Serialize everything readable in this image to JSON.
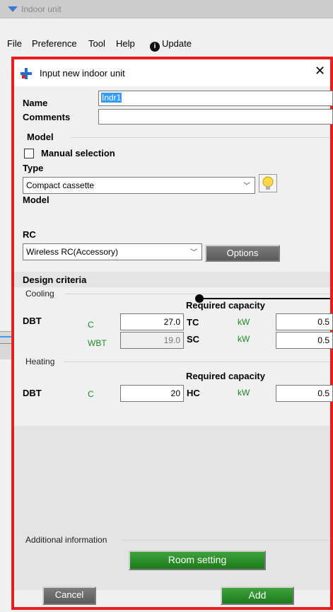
{
  "window": {
    "title": "Indoor unit"
  },
  "menu": {
    "file": "File",
    "preference": "Preference",
    "tool": "Tool",
    "help": "Help",
    "update": "Update"
  },
  "dialog": {
    "title": "Input new indoor unit",
    "name_label": "Name",
    "name_value": "Indr1",
    "comments_label": "Comments",
    "comments_value": "",
    "model_group": "Model",
    "manual_selection": "Manual selection",
    "manual_selection_checked": false,
    "type_label": "Type",
    "type_value": "Compact cassette",
    "model_label": "Model",
    "rc_label": "RC",
    "rc_value": "Wireless RC(Accessory)",
    "options_button": "Options",
    "design_criteria": "Design criteria",
    "cooling": {
      "group": "Cooling",
      "required_capacity": "Required capacity",
      "dbt_label": "DBT",
      "dbt_unit": "C",
      "dbt_value": "27.0",
      "wbt_unit": "WBT",
      "wbt_value": "19.0",
      "tc_label": "TC",
      "tc_unit": "kW",
      "tc_value": "0.5",
      "sc_label": "SC",
      "sc_unit": "kW",
      "sc_value": "0.5"
    },
    "heating": {
      "group": "Heating",
      "required_capacity": "Required capacity",
      "dbt_label": "DBT",
      "dbt_unit": "C",
      "dbt_value": "20",
      "hc_label": "HC",
      "hc_unit": "kW",
      "hc_value": "0.5"
    },
    "additional_information": "Additional information",
    "room_setting_button": "Room setting",
    "cancel_button": "Cancel",
    "add_button": "Add"
  },
  "colors": {
    "highlight_border": "#e61e1e",
    "button_green": "#2e8b2e",
    "unit_text": "#1a8a2a"
  }
}
